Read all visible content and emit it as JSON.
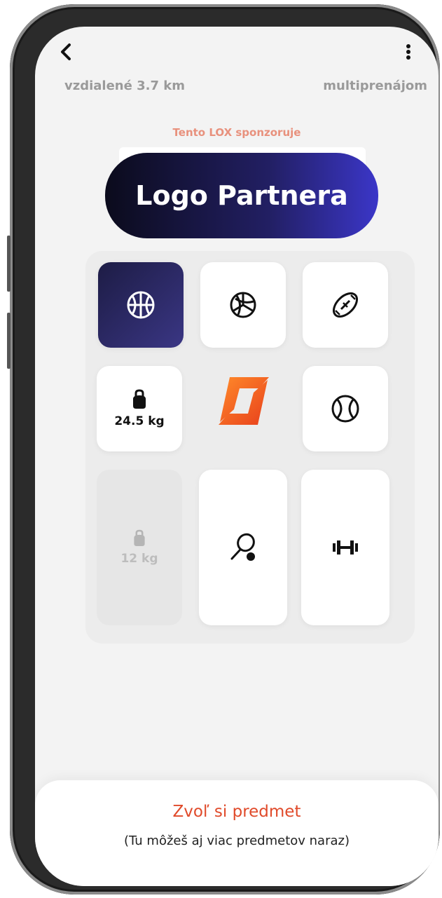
{
  "header": {
    "back_icon": "chevron-left-icon",
    "menu_icon": "more-vertical-icon",
    "distance_text": "vzdialené 3.7 km",
    "rental_mode_text": "multiprenájom"
  },
  "sponsor": {
    "label": "Tento LOX sponzoruje",
    "partner_logo_text": "Logo Partnera"
  },
  "grid": {
    "items": [
      {
        "name": "basketball",
        "icon": "basketball-icon",
        "selected": true
      },
      {
        "name": "volleyball",
        "icon": "volleyball-icon",
        "selected": false
      },
      {
        "name": "american-football",
        "icon": "american-football-icon",
        "selected": false
      },
      {
        "name": "kettlebell",
        "icon": "kettlebell-icon",
        "weight": "24.5 kg",
        "selected": false
      },
      {
        "name": "lox-logo",
        "icon": "lox-logo-icon",
        "selected": false
      },
      {
        "name": "tennis-ball",
        "icon": "tennis-ball-icon",
        "selected": false
      },
      {
        "name": "kettlebell-disabled",
        "icon": "kettlebell-icon",
        "weight": "12 kg",
        "disabled": true
      },
      {
        "name": "tennis-racket",
        "icon": "tennis-racket-icon",
        "selected": false
      },
      {
        "name": "dumbbell",
        "icon": "dumbbell-icon",
        "selected": false
      }
    ]
  },
  "footer": {
    "cta_title": "Zvoľ si predmet",
    "cta_subtitle": "(Tu môžeš aj viac predmetov naraz)"
  },
  "colors": {
    "accent_orange": "#e04a2a",
    "sponsor_label": "#e8917d",
    "selected_tile": "#2a2870",
    "pill_gradient_start": "#0b0b1c",
    "pill_gradient_end": "#3b36c8"
  }
}
